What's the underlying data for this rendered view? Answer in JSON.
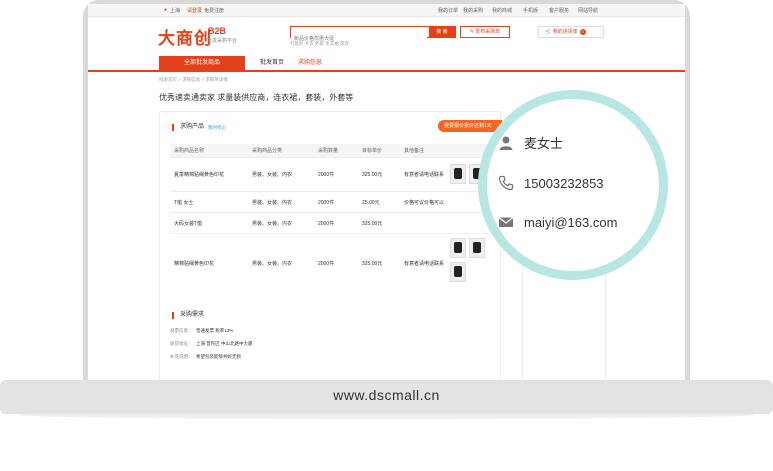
{
  "topbar": {
    "location": "上海",
    "login": "请登录",
    "register": "免费注册",
    "links": [
      "我的订单",
      "我的采购",
      "我的商城",
      "手机版",
      "客户服务",
      "网站导航"
    ]
  },
  "logo": {
    "brand": "大商创",
    "b2b": "B2B",
    "sub": "批发采购平台"
  },
  "search": {
    "placeholder": "新品价格优惠大促",
    "button": "搜 索",
    "hot": "打底衫  大衣  外套  毛衣裙  风衣"
  },
  "publish_button": "发布采购单",
  "cart": {
    "label": "我的进货单",
    "count": "0"
  },
  "nav": {
    "all": "全部批发商品",
    "items": [
      "批发首页",
      "求购信息"
    ]
  },
  "breadcrumb": "批发首页 > 求购信息 > 求购单详情",
  "page_title": "优秀速卖通卖家 求量装供应商，连衣裙，套装，外套等",
  "product_section": {
    "title": "求购产品",
    "subtitle": "暂时停止"
  },
  "quote_button": "我要报价报价还剩1天",
  "table": {
    "headers": [
      "采购商品名称",
      "采购商品分类",
      "采购数量",
      "目标单价",
      "其他备注"
    ],
    "rows": [
      {
        "name": "夏季精棉贴绳黄色印花",
        "category": "男装、女装、内衣",
        "qty": "2000件",
        "price": "325.00元",
        "note": "有意者请电话联系"
      },
      {
        "name": "T恤 女士",
        "category": "男装、女装、内衣",
        "qty": "2000件",
        "price": "25.00元",
        "note": "价格可议价格可以"
      },
      {
        "name": "大码女装T恤",
        "category": "男装、女装、内衣",
        "qty": "2000件",
        "price": "325.00元",
        "note": ""
      },
      {
        "name": "精棉贴绳黄色印花",
        "category": "男装、女装、内衣",
        "qty": "2000件",
        "price": "325.00元",
        "note": "有意者请电话联系"
      }
    ]
  },
  "demand_section": {
    "title": "采购需求"
  },
  "demand": [
    {
      "label": "发票信息：",
      "value": "普通发票  税率13%"
    },
    {
      "label": "收货地址：",
      "value": "上海  普陀区  中山北路中大厦"
    },
    {
      "label": "补充说明：",
      "value": "希望包装能够共好无损"
    }
  ],
  "contact": {
    "name": "麦女士",
    "phone": "15003232853",
    "email": "maiyi@163.com"
  },
  "site_url": "www.dscmall.cn"
}
